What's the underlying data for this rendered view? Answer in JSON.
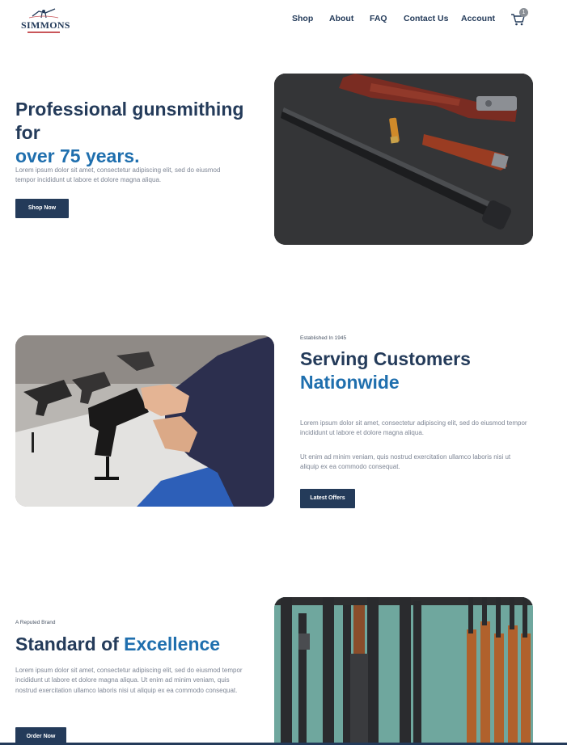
{
  "brand": {
    "name": "SIMMONS",
    "accent_color": "#c9565a"
  },
  "nav": {
    "items": [
      "Shop",
      "About",
      "FAQ",
      "Contact Us",
      "Account"
    ],
    "cart_count": "1"
  },
  "colors": {
    "primary": "#243b5a",
    "accent": "#1f6fae",
    "body_text": "#7d8594"
  },
  "hero": {
    "title": "Professional gunsmithing for",
    "title_accent": "over 75 years.",
    "body": "Lorem ipsum dolor sit amet, consectetur adipiscing elit, sed do eiusmod tempor incididunt ut labore et dolore magna aliqua.",
    "button": "Shop Now",
    "image_alt": "disassembled-shotgun-photo"
  },
  "service": {
    "eyebrow": "Established In 1945",
    "title": "Serving Customers",
    "title_accent": "Nationwide",
    "body1": "Lorem ipsum dolor sit amet, consectetur adipiscing elit, sed do eiusmod tempor incididunt ut labore et dolore magna aliqua.",
    "body2": "Ut enim ad minim veniam, quis nostrud exercitation ullamco laboris nisi ut aliquip ex ea commodo consequat.",
    "button": "Latest Offers",
    "image_alt": "handgun-display-photo"
  },
  "excellence": {
    "eyebrow": "A Reputed Brand",
    "title": "Standard of ",
    "title_accent": "Excellence",
    "body": "Lorem ipsum dolor sit amet, consectetur adipiscing elit, sed do eiusmod tempor incididunt ut labore et dolore magna aliqua. Ut enim ad minim veniam, quis nostrud exercitation ullamco laboris nisi ut aliquip ex ea commodo consequat.",
    "button": "Order Now",
    "image_alt": "shotgun-rack-photo"
  }
}
